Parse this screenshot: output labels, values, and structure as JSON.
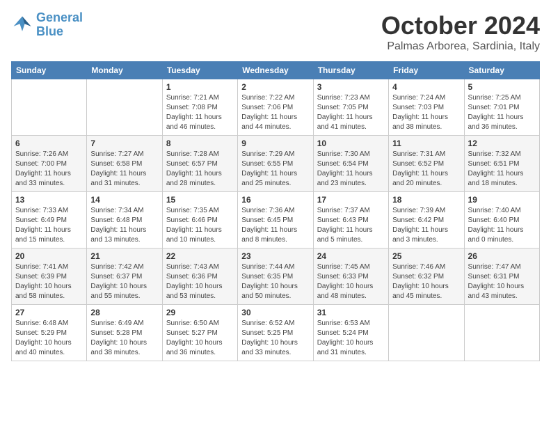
{
  "header": {
    "logo_line1": "General",
    "logo_line2": "Blue",
    "month_title": "October 2024",
    "subtitle": "Palmas Arborea, Sardinia, Italy"
  },
  "weekdays": [
    "Sunday",
    "Monday",
    "Tuesday",
    "Wednesday",
    "Thursday",
    "Friday",
    "Saturday"
  ],
  "weeks": [
    [
      {
        "day": "",
        "info": ""
      },
      {
        "day": "",
        "info": ""
      },
      {
        "day": "1",
        "info": "Sunrise: 7:21 AM\nSunset: 7:08 PM\nDaylight: 11 hours\nand 46 minutes."
      },
      {
        "day": "2",
        "info": "Sunrise: 7:22 AM\nSunset: 7:06 PM\nDaylight: 11 hours\nand 44 minutes."
      },
      {
        "day": "3",
        "info": "Sunrise: 7:23 AM\nSunset: 7:05 PM\nDaylight: 11 hours\nand 41 minutes."
      },
      {
        "day": "4",
        "info": "Sunrise: 7:24 AM\nSunset: 7:03 PM\nDaylight: 11 hours\nand 38 minutes."
      },
      {
        "day": "5",
        "info": "Sunrise: 7:25 AM\nSunset: 7:01 PM\nDaylight: 11 hours\nand 36 minutes."
      }
    ],
    [
      {
        "day": "6",
        "info": "Sunrise: 7:26 AM\nSunset: 7:00 PM\nDaylight: 11 hours\nand 33 minutes."
      },
      {
        "day": "7",
        "info": "Sunrise: 7:27 AM\nSunset: 6:58 PM\nDaylight: 11 hours\nand 31 minutes."
      },
      {
        "day": "8",
        "info": "Sunrise: 7:28 AM\nSunset: 6:57 PM\nDaylight: 11 hours\nand 28 minutes."
      },
      {
        "day": "9",
        "info": "Sunrise: 7:29 AM\nSunset: 6:55 PM\nDaylight: 11 hours\nand 25 minutes."
      },
      {
        "day": "10",
        "info": "Sunrise: 7:30 AM\nSunset: 6:54 PM\nDaylight: 11 hours\nand 23 minutes."
      },
      {
        "day": "11",
        "info": "Sunrise: 7:31 AM\nSunset: 6:52 PM\nDaylight: 11 hours\nand 20 minutes."
      },
      {
        "day": "12",
        "info": "Sunrise: 7:32 AM\nSunset: 6:51 PM\nDaylight: 11 hours\nand 18 minutes."
      }
    ],
    [
      {
        "day": "13",
        "info": "Sunrise: 7:33 AM\nSunset: 6:49 PM\nDaylight: 11 hours\nand 15 minutes."
      },
      {
        "day": "14",
        "info": "Sunrise: 7:34 AM\nSunset: 6:48 PM\nDaylight: 11 hours\nand 13 minutes."
      },
      {
        "day": "15",
        "info": "Sunrise: 7:35 AM\nSunset: 6:46 PM\nDaylight: 11 hours\nand 10 minutes."
      },
      {
        "day": "16",
        "info": "Sunrise: 7:36 AM\nSunset: 6:45 PM\nDaylight: 11 hours\nand 8 minutes."
      },
      {
        "day": "17",
        "info": "Sunrise: 7:37 AM\nSunset: 6:43 PM\nDaylight: 11 hours\nand 5 minutes."
      },
      {
        "day": "18",
        "info": "Sunrise: 7:39 AM\nSunset: 6:42 PM\nDaylight: 11 hours\nand 3 minutes."
      },
      {
        "day": "19",
        "info": "Sunrise: 7:40 AM\nSunset: 6:40 PM\nDaylight: 11 hours\nand 0 minutes."
      }
    ],
    [
      {
        "day": "20",
        "info": "Sunrise: 7:41 AM\nSunset: 6:39 PM\nDaylight: 10 hours\nand 58 minutes."
      },
      {
        "day": "21",
        "info": "Sunrise: 7:42 AM\nSunset: 6:37 PM\nDaylight: 10 hours\nand 55 minutes."
      },
      {
        "day": "22",
        "info": "Sunrise: 7:43 AM\nSunset: 6:36 PM\nDaylight: 10 hours\nand 53 minutes."
      },
      {
        "day": "23",
        "info": "Sunrise: 7:44 AM\nSunset: 6:35 PM\nDaylight: 10 hours\nand 50 minutes."
      },
      {
        "day": "24",
        "info": "Sunrise: 7:45 AM\nSunset: 6:33 PM\nDaylight: 10 hours\nand 48 minutes."
      },
      {
        "day": "25",
        "info": "Sunrise: 7:46 AM\nSunset: 6:32 PM\nDaylight: 10 hours\nand 45 minutes."
      },
      {
        "day": "26",
        "info": "Sunrise: 7:47 AM\nSunset: 6:31 PM\nDaylight: 10 hours\nand 43 minutes."
      }
    ],
    [
      {
        "day": "27",
        "info": "Sunrise: 6:48 AM\nSunset: 5:29 PM\nDaylight: 10 hours\nand 40 minutes."
      },
      {
        "day": "28",
        "info": "Sunrise: 6:49 AM\nSunset: 5:28 PM\nDaylight: 10 hours\nand 38 minutes."
      },
      {
        "day": "29",
        "info": "Sunrise: 6:50 AM\nSunset: 5:27 PM\nDaylight: 10 hours\nand 36 minutes."
      },
      {
        "day": "30",
        "info": "Sunrise: 6:52 AM\nSunset: 5:25 PM\nDaylight: 10 hours\nand 33 minutes."
      },
      {
        "day": "31",
        "info": "Sunrise: 6:53 AM\nSunset: 5:24 PM\nDaylight: 10 hours\nand 31 minutes."
      },
      {
        "day": "",
        "info": ""
      },
      {
        "day": "",
        "info": ""
      }
    ]
  ]
}
